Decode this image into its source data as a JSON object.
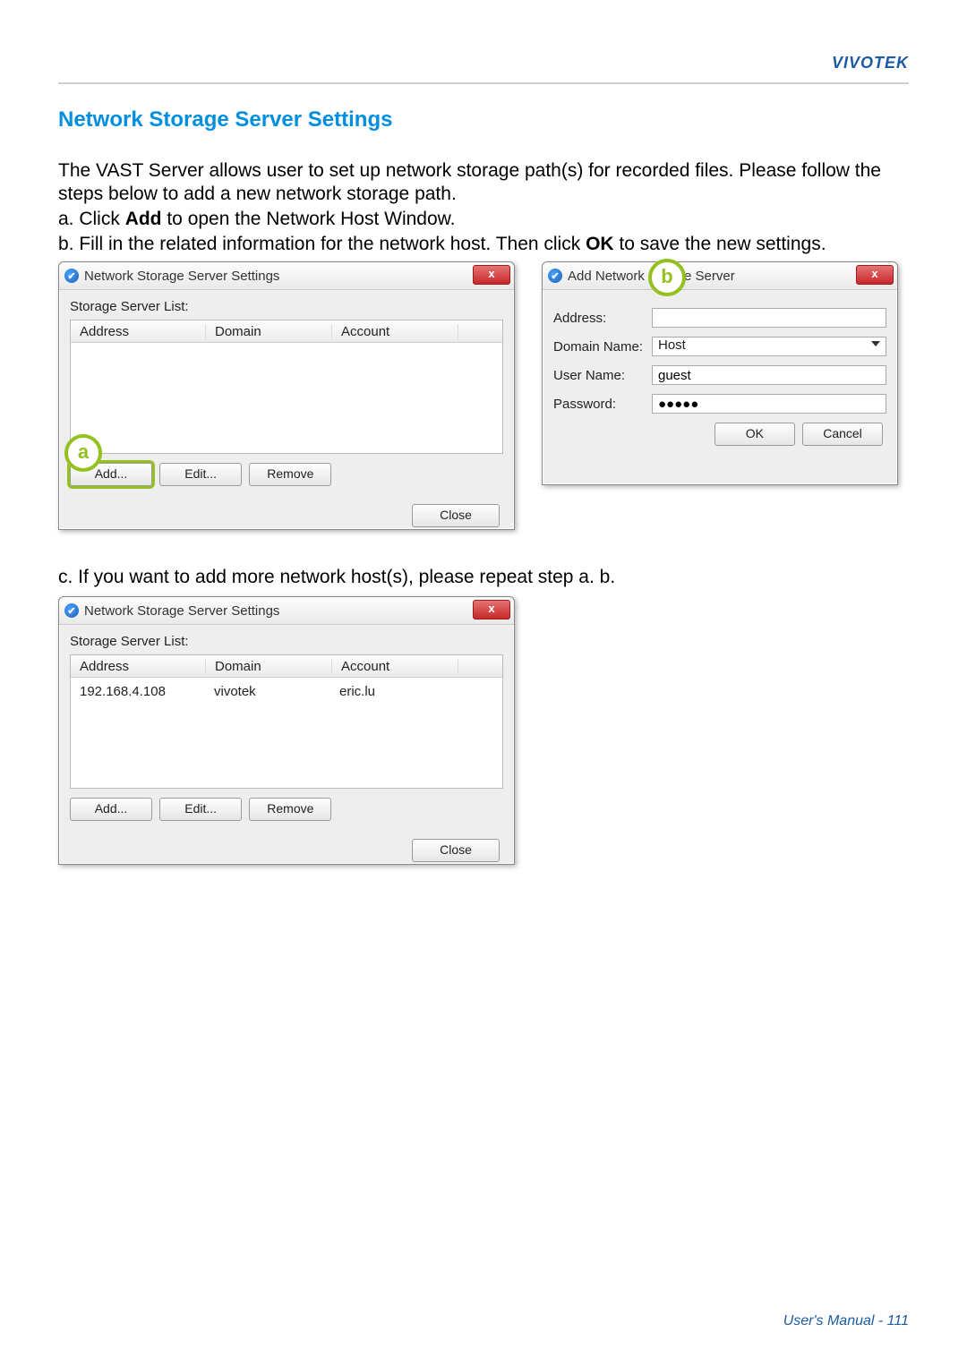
{
  "brand": "VIVOTEK",
  "section_title": "Network Storage Server Settings",
  "para1": "The VAST Server allows user to set up network storage path(s) for recorded files. Please follow the steps below to add a new network storage path.",
  "step_a_pre": "a. Click ",
  "step_a_bold": "Add",
  "step_a_post": " to open the Network Host Window.",
  "step_b_pre": "b. Fill in the related information for the network host. Then click ",
  "step_b_bold": "OK",
  "step_b_post": " to save the new settings.",
  "step_c": "c. If you want to add more network host(s), please repeat step a. b.",
  "badge_a": "a",
  "badge_b": "b",
  "win_close": "x",
  "window1": {
    "title": "Network Storage Server Settings",
    "list_label": "Storage Server List:",
    "headers": {
      "address": "Address",
      "domain": "Domain",
      "account": "Account"
    },
    "buttons": {
      "add": "Add...",
      "edit": "Edit...",
      "remove": "Remove",
      "close": "Close"
    }
  },
  "window2": {
    "title_left": "Add Network S",
    "title_right": "e Server",
    "labels": {
      "address": "Address:",
      "domain": "Domain Name:",
      "user": "User Name:",
      "password": "Password:"
    },
    "values": {
      "address": "",
      "domain": "Host",
      "user": "guest",
      "password": "●●●●●"
    },
    "buttons": {
      "ok": "OK",
      "cancel": "Cancel"
    }
  },
  "window3": {
    "title": "Network Storage Server Settings",
    "list_label": "Storage Server List:",
    "headers": {
      "address": "Address",
      "domain": "Domain",
      "account": "Account"
    },
    "rows": [
      {
        "address": "192.168.4.108",
        "domain": "vivotek",
        "account": "eric.lu"
      }
    ],
    "buttons": {
      "add": "Add...",
      "edit": "Edit...",
      "remove": "Remove",
      "close": "Close"
    }
  },
  "footer_label": "User's Manual - ",
  "footer_page": "111"
}
